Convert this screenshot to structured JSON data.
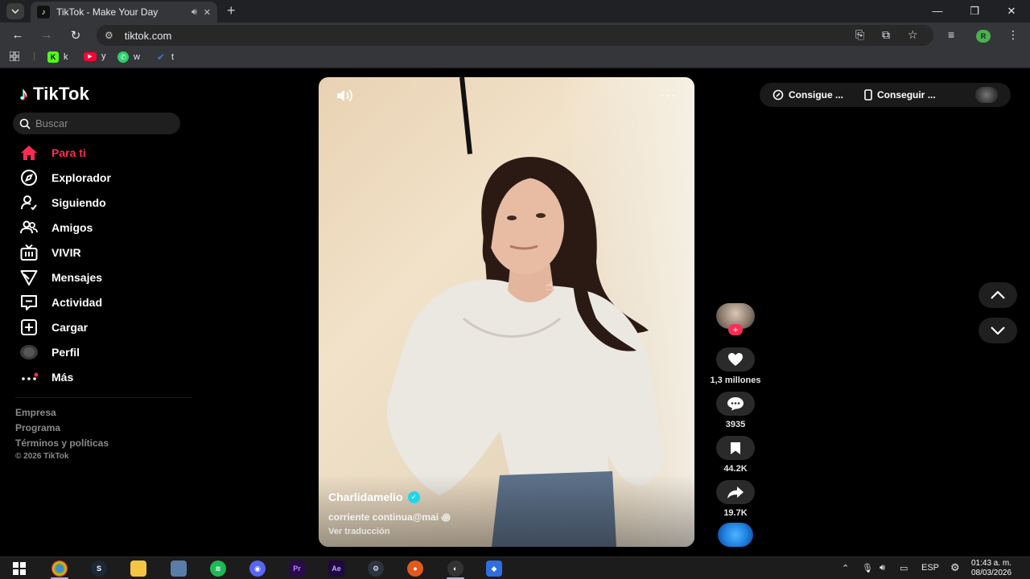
{
  "browser": {
    "tab_title": "TikTok - Make Your Day",
    "url": "tiktok.com",
    "profile_initial": "R",
    "bookmarks": [
      {
        "label": "k",
        "icon": "kick-icon",
        "color": "#53fc18"
      },
      {
        "label": "y",
        "icon": "youtube-icon",
        "color": "#ff0033"
      },
      {
        "label": "w",
        "icon": "whatsapp-icon",
        "color": "#25d366"
      },
      {
        "label": "t",
        "icon": "twitch-icon",
        "color": "#2f7bd8"
      }
    ]
  },
  "tiktok": {
    "brand": "TikTok",
    "search_placeholder": "Buscar",
    "nav": [
      {
        "label": "Para ti",
        "icon": "home-icon",
        "active": true
      },
      {
        "label": "Explorador",
        "icon": "compass-icon"
      },
      {
        "label": "Siguiendo",
        "icon": "following-icon"
      },
      {
        "label": "Amigos",
        "icon": "friends-icon"
      },
      {
        "label": "VIVIR",
        "icon": "live-tv-icon"
      },
      {
        "label": "Mensajes",
        "icon": "send-icon"
      },
      {
        "label": "Actividad",
        "icon": "activity-icon"
      },
      {
        "label": "Cargar",
        "icon": "upload-icon"
      },
      {
        "label": "Perfil",
        "icon": "profile-avatar-icon"
      },
      {
        "label": "Más",
        "icon": "more-icon"
      }
    ],
    "footer": {
      "company": "Empresa",
      "program": "Programa",
      "terms": "Términos y políticas",
      "copyright": "© 2026 TikTok"
    },
    "top_right": {
      "get_coins": "Consigue ...",
      "get_app": "Conseguir ..."
    },
    "video": {
      "author": "Charlidamelio",
      "caption": "corriente continua@mai ꩜",
      "translate": "Ver traducción"
    },
    "actions": {
      "likes": "1,3 millones",
      "comments": "3935",
      "saves": "44.2K",
      "shares": "19.7K"
    }
  },
  "taskbar": {
    "language": "ESP",
    "time": "01:43 a. m.",
    "date": "08/03/2026"
  },
  "colors": {
    "accent": "#fe2c55",
    "verified": "#20d5ec",
    "background": "#000000"
  }
}
